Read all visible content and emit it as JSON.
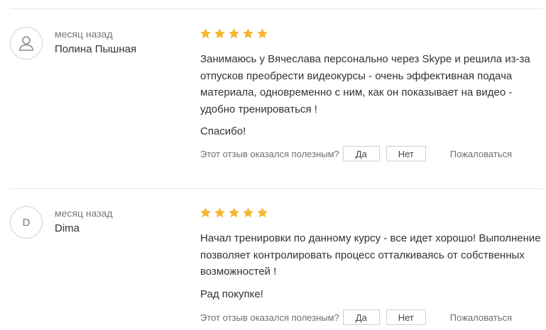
{
  "reviews": [
    {
      "date": "месяц назад",
      "author": "Полина Пышная",
      "avatar_icon": "user-icon",
      "avatar_letter": "",
      "rating": 5,
      "body": "Занимаюсь у Вячеслава персонально через Skype и решила из-за отпусков преобрести видеокурсы - очень эффективная подача материала, одновременно с ним, как он показывает на видео - удобно тренироваться !",
      "closing": "Спасибо!",
      "helpful_question": "Этот отзыв оказался полезным?",
      "yes_label": "Да",
      "no_label": "Нет",
      "report_label": "Пожаловаться"
    },
    {
      "date": "месяц назад",
      "author": "Dima",
      "avatar_icon": "",
      "avatar_letter": "D",
      "rating": 5,
      "body": "Начал тренировки по данному курсу - все идет хорошо! Выполнение позволяет контролировать процесс отталкиваясь от собственных возможностей !",
      "closing": "Рад покупке!",
      "helpful_question": "Этот отзыв оказался полезным?",
      "yes_label": "Да",
      "no_label": "Нет",
      "report_label": "Пожаловаться"
    }
  ],
  "colors": {
    "star": "#f5b731",
    "divider": "#e6e6e6",
    "muted_text": "#777777"
  }
}
